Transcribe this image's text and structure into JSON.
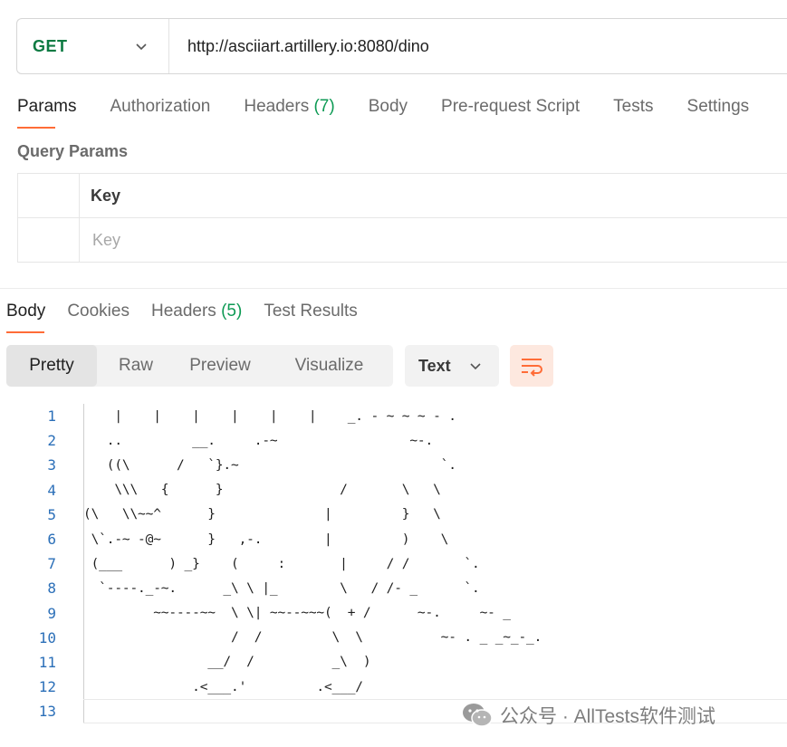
{
  "request": {
    "method": "GET",
    "url": "http://asciiart.artillery.io:8080/dino"
  },
  "request_tabs": [
    {
      "label": "Params",
      "count": ""
    },
    {
      "label": "Authorization",
      "count": ""
    },
    {
      "label": "Headers",
      "count": "(7)"
    },
    {
      "label": "Body",
      "count": ""
    },
    {
      "label": "Pre-request Script",
      "count": ""
    },
    {
      "label": "Tests",
      "count": ""
    },
    {
      "label": "Settings",
      "count": ""
    }
  ],
  "query_params": {
    "title": "Query Params",
    "key_header": "Key",
    "key_placeholder": "Key"
  },
  "response_tabs": [
    {
      "label": "Body",
      "count": ""
    },
    {
      "label": "Cookies",
      "count": ""
    },
    {
      "label": "Headers",
      "count": "(5)"
    },
    {
      "label": "Test Results",
      "count": ""
    }
  ],
  "view_modes": [
    "Pretty",
    "Raw",
    "Preview",
    "Visualize"
  ],
  "format": "Text",
  "code_lines": [
    "    |    |    |    |    |    |    _. - ~ ~ ~ - .",
    "   ..         __.     .-~                 ~-.",
    "   ((\\      /   `}.~                          `.",
    "    \\\\\\   {      }               /       \\   \\",
    "(\\   \\\\~~^      }              |         }   \\",
    " \\`.-~ -@~      }   ,-.        |         )    \\",
    " (___      ) _}    (     :       |     / /       `.",
    "  `----._-~.      _\\ \\ |_        \\   / /- _      `.",
    "         ~~----~~  \\ \\| ~~--~~~(  + /      ~-.     ~- _",
    "                   /  /         \\  \\          ~- . _ _~_-_.",
    "                __/  /          _\\  )",
    "              .<___.'         .<___/",
    ""
  ],
  "watermark": "公众号 · AllTests软件测试",
  "colors": {
    "accent": "#ff6c37",
    "method_get": "#0d7a42",
    "count": "#0d9a54",
    "line_number": "#2b6fb8"
  }
}
